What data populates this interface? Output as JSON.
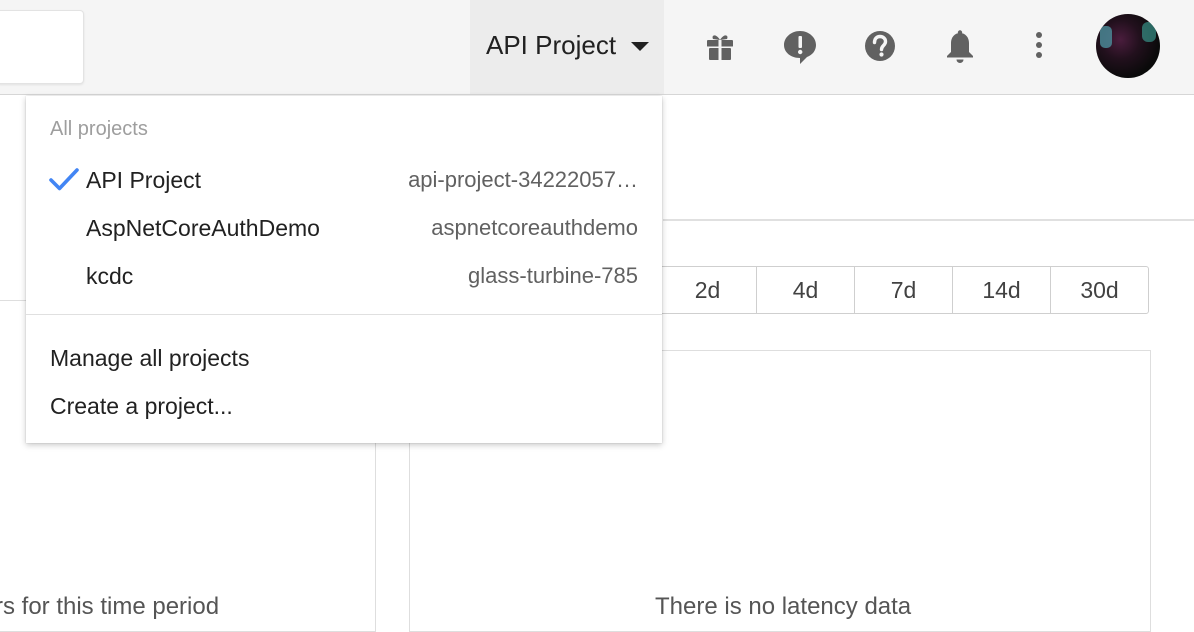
{
  "topbar": {
    "project_name": "API Project",
    "icons": [
      "gift-icon",
      "feedback-icon",
      "help-icon",
      "notifications-icon",
      "more-vert-icon"
    ]
  },
  "project_menu": {
    "header": "All projects",
    "projects": [
      {
        "name": "API Project",
        "id": "api-project-34222057…",
        "selected": true
      },
      {
        "name": "AspNetCoreAuthDemo",
        "id": "aspnetcoreauthdemo",
        "selected": false
      },
      {
        "name": "kcdc",
        "id": "glass-turbine-785",
        "selected": false
      }
    ],
    "actions": {
      "manage": "Manage all projects",
      "create": "Create a project..."
    }
  },
  "time_range": {
    "options": [
      "2d",
      "4d",
      "7d",
      "14d",
      "30d"
    ]
  },
  "cards": {
    "left_message": "rs for this time period",
    "right_message": "There is no latency data"
  },
  "colors": {
    "check": "#4285f4",
    "icon": "#616161"
  }
}
